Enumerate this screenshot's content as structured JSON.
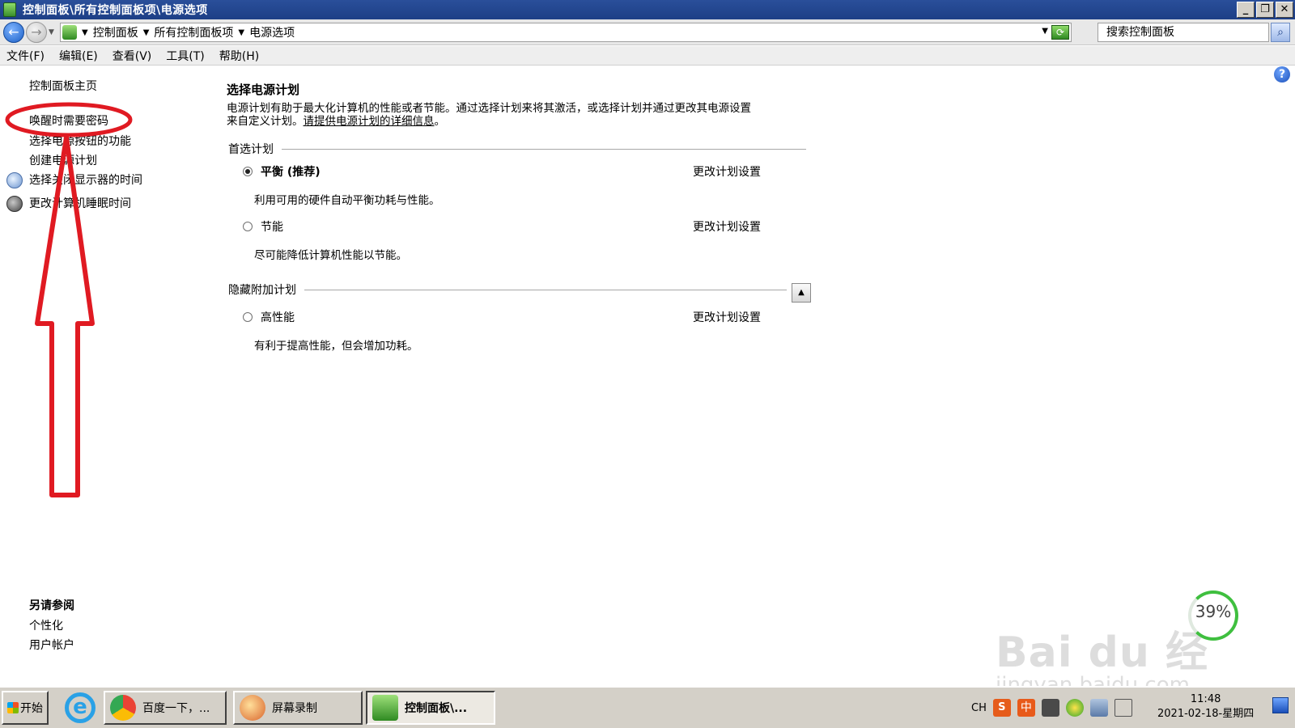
{
  "window": {
    "title": "控制面板\\所有控制面板项\\电源选项"
  },
  "address": {
    "crumbs": [
      "控制面板",
      "所有控制面板项",
      "电源选项"
    ],
    "search_placeholder": "搜索控制面板"
  },
  "menu": [
    "文件(F)",
    "编辑(E)",
    "查看(V)",
    "工具(T)",
    "帮助(H)"
  ],
  "sidebar": {
    "home": "控制面板主页",
    "tasks": [
      "唤醒时需要密码",
      "选择电源按钮的功能",
      "创建电源计划",
      "选择关闭显示器的时间",
      "更改计算机睡眠时间"
    ],
    "see_also_heading": "另请参阅",
    "see_also": [
      "个性化",
      "用户帐户"
    ]
  },
  "main": {
    "title": "选择电源计划",
    "description_1": "电源计划有助于最大化计算机的性能或者节能。通过选择计划来将其激活，或选择计划并通过更改其电源设置",
    "description_2": "来自定义计划。",
    "description_link": "请提供电源计划的详细信息",
    "description_end": "。",
    "preferred_label": "首选计划",
    "hidden_label": "隐藏附加计划",
    "plans": [
      {
        "name": "平衡 (推荐)",
        "desc": "利用可用的硬件自动平衡功耗与性能。",
        "change": "更改计划设置",
        "selected": true
      },
      {
        "name": "节能",
        "desc": "尽可能降低计算机性能以节能。",
        "change": "更改计划设置",
        "selected": false
      },
      {
        "name": "高性能",
        "desc": "有利于提高性能，但会增加功耗。",
        "change": "更改计划设置",
        "selected": false
      }
    ]
  },
  "watermark": {
    "main": "Bai du 经验",
    "sub": "jingyan.baidu.com"
  },
  "speed": {
    "percent": "39%"
  },
  "taskbar": {
    "start": "开始",
    "tasks": [
      "百度一下，...",
      "屏幕录制",
      "控制面板\\..."
    ],
    "tray_lang": "CH",
    "tray_sogou": "S",
    "tray_ime": "中",
    "time": "11:48",
    "date": "2021-02-18-星期四"
  },
  "colors": {
    "annotation": "#e01a22",
    "titlebar": "#1d3f86"
  }
}
